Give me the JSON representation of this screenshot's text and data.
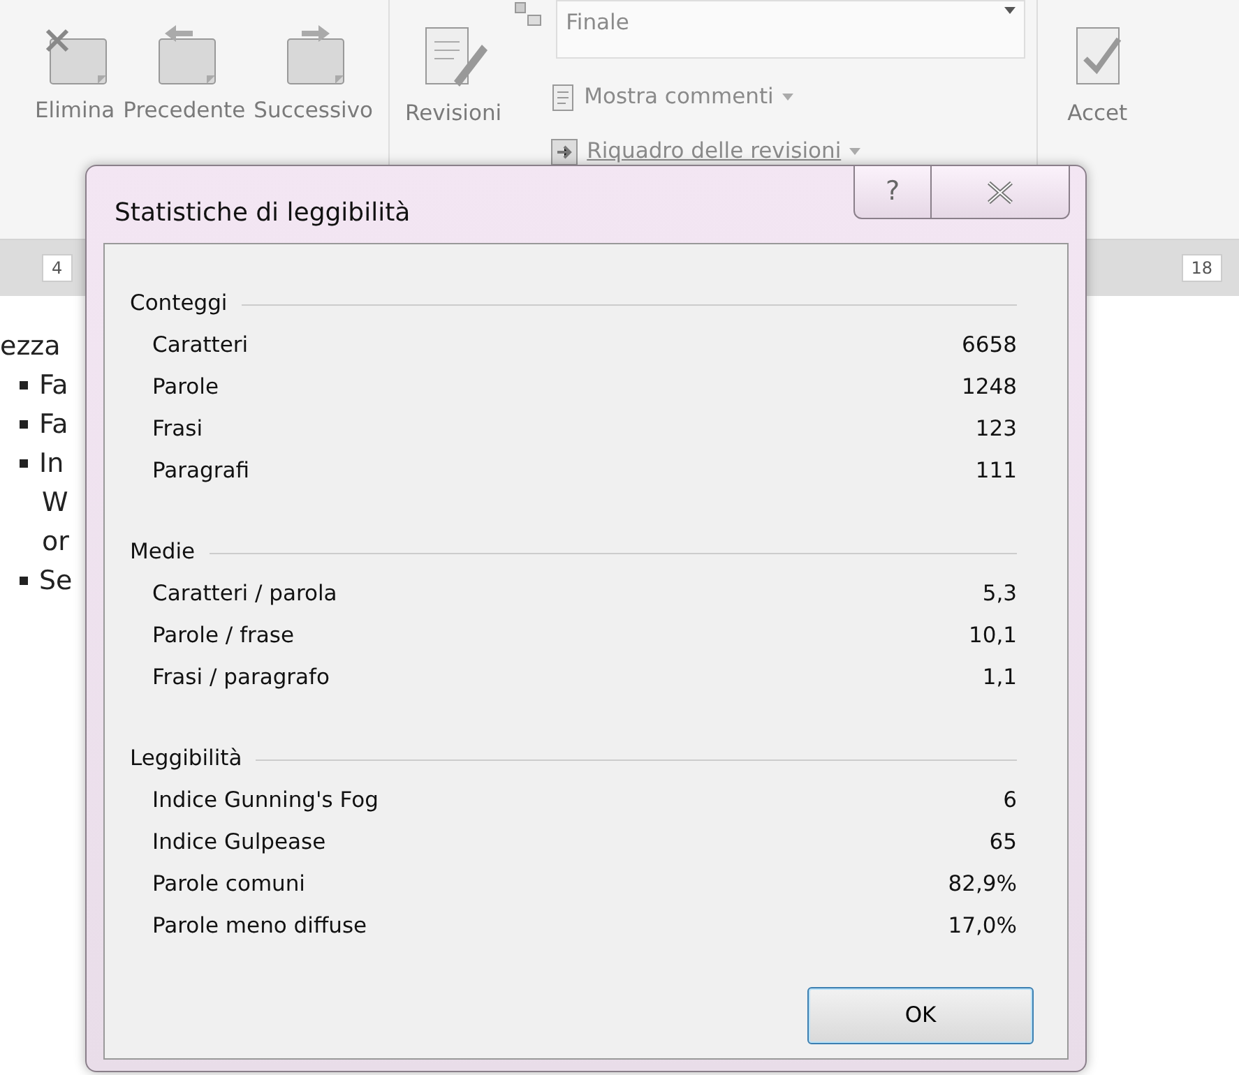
{
  "ribbon": {
    "buttons": [
      {
        "label": "Elimina",
        "kind": "delete"
      },
      {
        "label": "Precedente",
        "kind": "previous"
      },
      {
        "label": "Successivo",
        "kind": "next"
      }
    ],
    "review_button": {
      "label": "Revisioni"
    },
    "display_dropdown": {
      "value": "Finale"
    },
    "show_comments": {
      "label": "Mostra commenti"
    },
    "review_pane": {
      "label": "Riquadro delle revisioni"
    },
    "accept_button": {
      "label": "Accet"
    }
  },
  "ruler": {
    "labels": [
      "4",
      "18"
    ]
  },
  "document": {
    "lines": [
      {
        "kind": "text",
        "text": "ezza"
      },
      {
        "kind": "bullet",
        "text": "Fa"
      },
      {
        "kind": "bullet",
        "text": "Fa"
      },
      {
        "kind": "bullet",
        "text": "In"
      },
      {
        "kind": "text",
        "text": "W"
      },
      {
        "kind": "text",
        "text": "or"
      },
      {
        "kind": "bullet",
        "text": "Se"
      }
    ]
  },
  "dialog": {
    "title": "Statistiche di leggibilità",
    "help": "?",
    "sections": [
      {
        "title": "Conteggi",
        "rows": [
          {
            "label": "Caratteri",
            "value": "6658"
          },
          {
            "label": "Parole",
            "value": "1248"
          },
          {
            "label": "Frasi",
            "value": "123"
          },
          {
            "label": "Paragrafi",
            "value": "111"
          }
        ]
      },
      {
        "title": "Medie",
        "rows": [
          {
            "label": "Caratteri / parola",
            "value": "5,3"
          },
          {
            "label": "Parole / frase",
            "value": "10,1"
          },
          {
            "label": "Frasi / paragrafo",
            "value": "1,1"
          }
        ]
      },
      {
        "title": "Leggibilità",
        "rows": [
          {
            "label": "Indice Gunning's Fog",
            "value": "6"
          },
          {
            "label": "Indice Gulpease",
            "value": "65"
          },
          {
            "label": "Parole comuni",
            "value": "82,9%"
          },
          {
            "label": "Parole meno diffuse",
            "value": "17,0%"
          }
        ]
      }
    ],
    "ok_button": "OK"
  }
}
